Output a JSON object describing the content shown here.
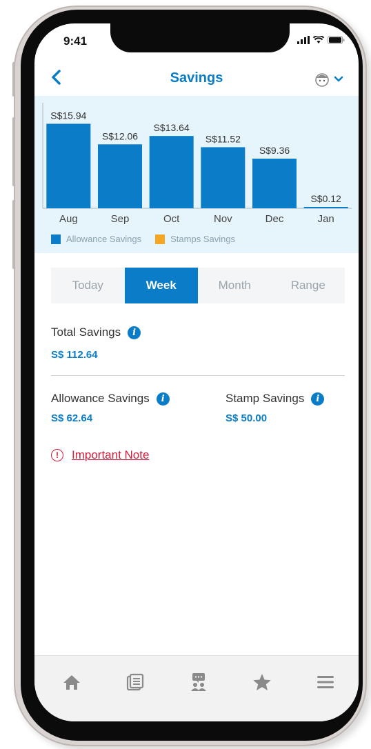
{
  "status": {
    "time": "9:41"
  },
  "header": {
    "title": "Savings"
  },
  "chart_data": {
    "type": "bar",
    "categories": [
      "Aug",
      "Sep",
      "Oct",
      "Nov",
      "Dec",
      "Jan"
    ],
    "series": [
      {
        "name": "Allowance Savings",
        "values": [
          15.94,
          12.06,
          13.64,
          11.52,
          9.36,
          0.12
        ]
      }
    ],
    "data_labels": [
      "S$15.94",
      "S$12.06",
      "S$13.64",
      "S$11.52",
      "S$9.36",
      "S$0.12"
    ],
    "legend": [
      "Allowance Savings",
      "Stamps Savings"
    ],
    "legend_colors": [
      "#0a7cc8",
      "#f5a623"
    ],
    "legend_placement": "bottom",
    "ylim": [
      0,
      16
    ],
    "grid": false
  },
  "segments": [
    "Today",
    "Week",
    "Month",
    "Range"
  ],
  "active_segment": "Week",
  "totals": {
    "total_label": "Total Savings",
    "total_value": "S$ 112.64",
    "allowance_label": "Allowance Savings",
    "allowance_value": "S$ 62.64",
    "stamp_label": "Stamp Savings",
    "stamp_value": "S$ 50.00"
  },
  "note": {
    "label": "Important Note"
  },
  "nav": [
    "home-icon",
    "news-icon",
    "community-icon",
    "star-icon",
    "menu-icon"
  ],
  "colors": {
    "accent": "#0a7cc8",
    "warning": "#d01c3b",
    "chart_bg": "#e6f4fb"
  }
}
